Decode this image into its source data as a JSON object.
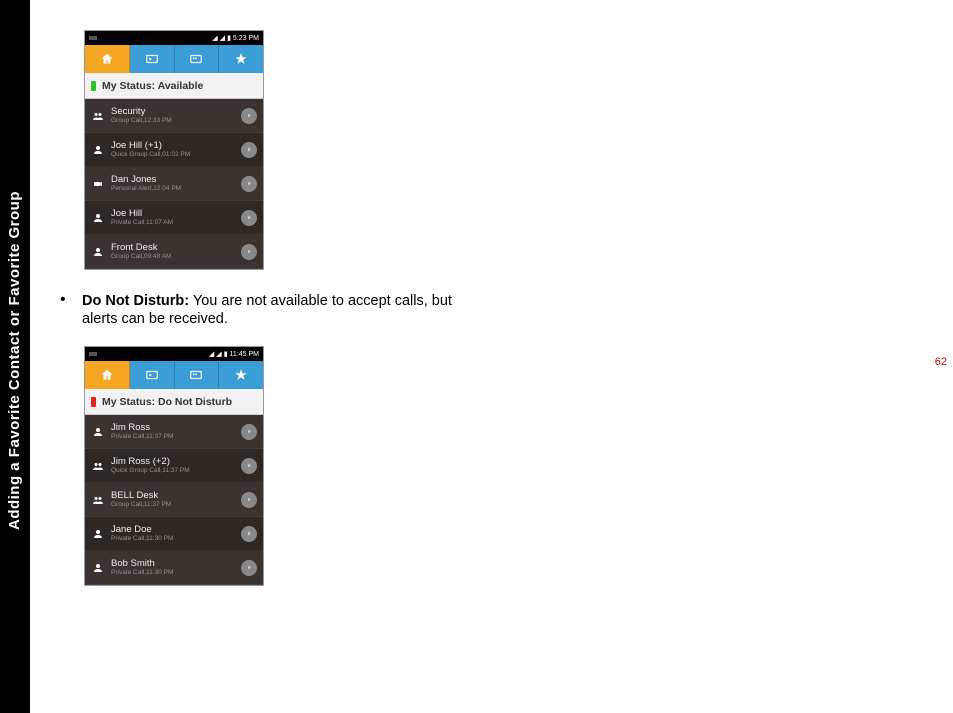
{
  "side_title": "Adding a Favorite Contact or Favorite Group",
  "page_number": "62",
  "bullet": {
    "bold": "Do Not Disturb:",
    "rest": " You are not available to accept calls, but alerts can be received."
  },
  "phone1": {
    "time": "5:23 PM",
    "status_label": "My Status: Available",
    "rows": [
      {
        "name": "Security",
        "sub": "Group Call,12:33 PM",
        "shade": "dark",
        "icon": "group"
      },
      {
        "name": "Joe Hill (+1)",
        "sub": "Quick Group Call,01:02 PM",
        "shade": "darker",
        "icon": "person"
      },
      {
        "name": "Dan Jones",
        "sub": "Personal Alert,12:04 PM",
        "shade": "dark",
        "icon": "alert"
      },
      {
        "name": "Joe Hill",
        "sub": "Private Call,11:07 AM",
        "shade": "darker",
        "icon": "person"
      },
      {
        "name": "Front Desk",
        "sub": "Group Call,09:48 AM",
        "shade": "dark",
        "icon": "person"
      }
    ]
  },
  "phone2": {
    "time": "11:45 PM",
    "status_label": "My Status: Do Not Disturb",
    "rows": [
      {
        "name": "Jim Ross",
        "sub": "Private Call,11:37 PM",
        "shade": "dark",
        "icon": "person"
      },
      {
        "name": "Jim Ross (+2)",
        "sub": "Quick Group Call,11:37 PM",
        "shade": "darker",
        "icon": "group"
      },
      {
        "name": "BELL Desk",
        "sub": "Group Call,11:37 PM",
        "shade": "dark",
        "icon": "group"
      },
      {
        "name": "Jane Doe",
        "sub": "Private Call,11:30 PM",
        "shade": "darker",
        "icon": "person"
      },
      {
        "name": "Bob Smith",
        "sub": "Private Call,11:30 PM",
        "shade": "dark",
        "icon": "person"
      }
    ]
  }
}
